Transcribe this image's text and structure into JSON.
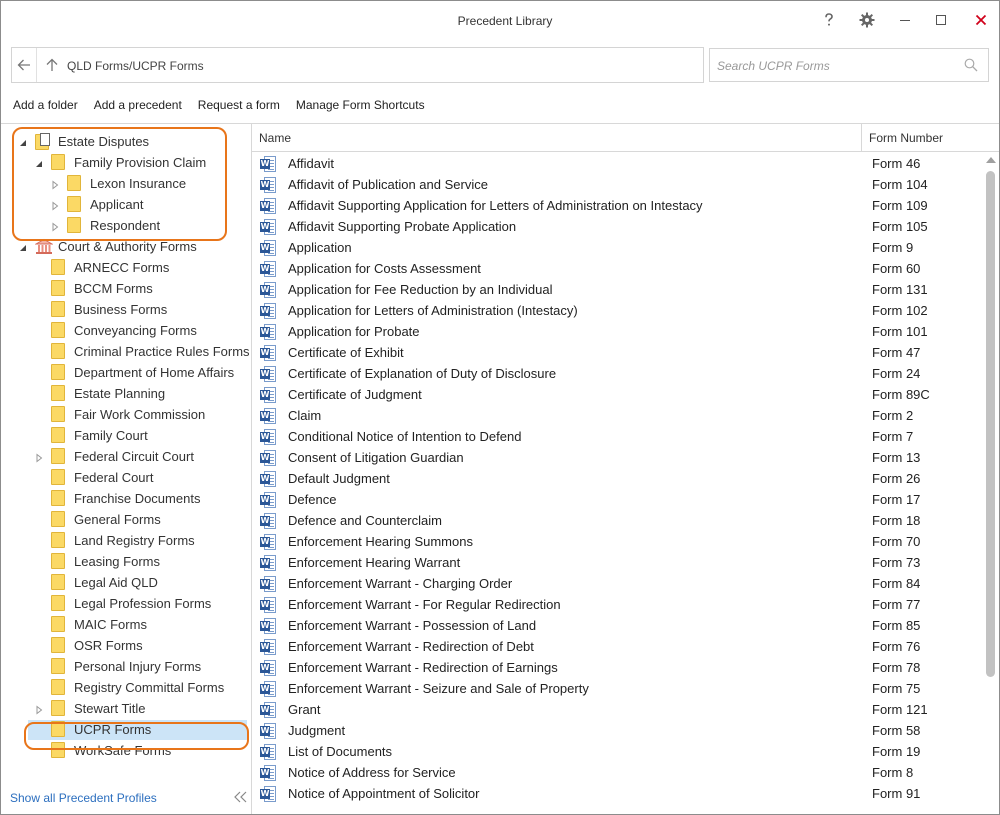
{
  "window": {
    "title": "Precedent Library",
    "buttons": [
      "help-icon",
      "gear-icon",
      "minimize-icon",
      "maximize-icon",
      "close-icon"
    ],
    "close_color": "#d0021b"
  },
  "nav": {
    "path": "QLD Forms/UCPR Forms",
    "search_placeholder": "Search UCPR Forms"
  },
  "toolbar": {
    "add_folder": "Add a folder",
    "add_precedent": "Add a precedent",
    "request_form": "Request a form",
    "manage_shortcuts": "Manage Form Shortcuts"
  },
  "tree": {
    "items": [
      {
        "label": "Estate Disputes",
        "level": 0,
        "expander": "expanded",
        "icon": "folder-document-icon"
      },
      {
        "label": "Family Provision Claim",
        "level": 1,
        "expander": "expanded",
        "icon": "folder-icon"
      },
      {
        "label": "Lexon Insurance",
        "level": 2,
        "expander": "collapsed",
        "icon": "folder-icon"
      },
      {
        "label": "Applicant",
        "level": 2,
        "expander": "collapsed",
        "icon": "folder-icon"
      },
      {
        "label": "Respondent",
        "level": 2,
        "expander": "collapsed",
        "icon": "folder-icon"
      },
      {
        "label": "Court & Authority Forms",
        "level": 0,
        "expander": "expanded",
        "icon": "court-building-icon"
      },
      {
        "label": "ARNECC Forms",
        "level": 1,
        "expander": "none",
        "icon": "folder-icon"
      },
      {
        "label": "BCCM Forms",
        "level": 1,
        "expander": "none",
        "icon": "folder-icon"
      },
      {
        "label": "Business Forms",
        "level": 1,
        "expander": "none",
        "icon": "folder-icon"
      },
      {
        "label": "Conveyancing Forms",
        "level": 1,
        "expander": "none",
        "icon": "folder-icon"
      },
      {
        "label": "Criminal Practice Rules Forms",
        "level": 1,
        "expander": "none",
        "icon": "folder-icon"
      },
      {
        "label": "Department of Home Affairs",
        "level": 1,
        "expander": "none",
        "icon": "folder-icon"
      },
      {
        "label": "Estate Planning",
        "level": 1,
        "expander": "none",
        "icon": "folder-icon"
      },
      {
        "label": "Fair Work Commission",
        "level": 1,
        "expander": "none",
        "icon": "folder-icon"
      },
      {
        "label": "Family Court",
        "level": 1,
        "expander": "none",
        "icon": "folder-icon"
      },
      {
        "label": "Federal Circuit Court",
        "level": 1,
        "expander": "collapsed",
        "icon": "folder-icon"
      },
      {
        "label": "Federal Court",
        "level": 1,
        "expander": "none",
        "icon": "folder-icon"
      },
      {
        "label": "Franchise Documents",
        "level": 1,
        "expander": "none",
        "icon": "folder-icon"
      },
      {
        "label": "General Forms",
        "level": 1,
        "expander": "none",
        "icon": "folder-icon"
      },
      {
        "label": "Land Registry Forms",
        "level": 1,
        "expander": "none",
        "icon": "folder-icon"
      },
      {
        "label": "Leasing Forms",
        "level": 1,
        "expander": "none",
        "icon": "folder-icon"
      },
      {
        "label": "Legal Aid QLD",
        "level": 1,
        "expander": "none",
        "icon": "folder-icon"
      },
      {
        "label": "Legal Profession Forms",
        "level": 1,
        "expander": "none",
        "icon": "folder-icon"
      },
      {
        "label": "MAIC Forms",
        "level": 1,
        "expander": "none",
        "icon": "folder-icon"
      },
      {
        "label": "OSR Forms",
        "level": 1,
        "expander": "none",
        "icon": "folder-icon"
      },
      {
        "label": "Personal Injury Forms",
        "level": 1,
        "expander": "none",
        "icon": "folder-icon"
      },
      {
        "label": "Registry Committal Forms",
        "level": 1,
        "expander": "none",
        "icon": "folder-icon"
      },
      {
        "label": "Stewart Title",
        "level": 1,
        "expander": "collapsed",
        "icon": "folder-icon"
      },
      {
        "label": "UCPR Forms",
        "level": 1,
        "expander": "none",
        "icon": "folder-icon",
        "selected": true
      },
      {
        "label": "WorkSafe Forms",
        "level": 1,
        "expander": "none",
        "icon": "folder-icon"
      }
    ],
    "show_all": "Show all Precedent Profiles"
  },
  "list": {
    "columns": {
      "name": "Name",
      "number": "Form Number"
    },
    "rows": [
      {
        "name": "Affidavit",
        "number": "Form 46"
      },
      {
        "name": "Affidavit of Publication and Service",
        "number": "Form 104"
      },
      {
        "name": "Affidavit Supporting Application for Letters of Administration on Intestacy",
        "number": "Form 109"
      },
      {
        "name": "Affidavit Supporting Probate Application",
        "number": "Form 105"
      },
      {
        "name": "Application",
        "number": "Form 9"
      },
      {
        "name": "Application for Costs Assessment",
        "number": "Form 60"
      },
      {
        "name": "Application for Fee Reduction by an Individual",
        "number": "Form 131"
      },
      {
        "name": "Application for Letters of Administration (Intestacy)",
        "number": "Form 102"
      },
      {
        "name": "Application for Probate",
        "number": "Form 101"
      },
      {
        "name": "Certificate of Exhibit",
        "number": "Form 47"
      },
      {
        "name": "Certificate of Explanation of Duty of Disclosure",
        "number": "Form 24"
      },
      {
        "name": "Certificate of Judgment",
        "number": "Form 89C"
      },
      {
        "name": "Claim",
        "number": "Form 2"
      },
      {
        "name": "Conditional Notice of Intention to Defend",
        "number": "Form 7"
      },
      {
        "name": "Consent of Litigation Guardian",
        "number": "Form 13"
      },
      {
        "name": "Default Judgment",
        "number": "Form 26"
      },
      {
        "name": "Defence",
        "number": "Form 17"
      },
      {
        "name": "Defence and Counterclaim",
        "number": "Form 18"
      },
      {
        "name": "Enforcement Hearing Summons",
        "number": "Form 70"
      },
      {
        "name": "Enforcement Hearing Warrant",
        "number": "Form 73"
      },
      {
        "name": "Enforcement Warrant - Charging Order",
        "number": "Form 84"
      },
      {
        "name": "Enforcement Warrant - For Regular Redirection",
        "number": "Form 77"
      },
      {
        "name": "Enforcement Warrant - Possession of Land",
        "number": "Form 85"
      },
      {
        "name": "Enforcement Warrant - Redirection of Debt",
        "number": "Form 76"
      },
      {
        "name": "Enforcement Warrant - Redirection of Earnings",
        "number": "Form 78"
      },
      {
        "name": "Enforcement Warrant - Seizure and Sale of Property",
        "number": "Form 75"
      },
      {
        "name": "Grant",
        "number": "Form 121"
      },
      {
        "name": "Judgment",
        "number": "Form 58"
      },
      {
        "name": "List of Documents",
        "number": "Form 19"
      },
      {
        "name": "Notice of Address for Service",
        "number": "Form 8"
      },
      {
        "name": "Notice of Appointment of Solicitor",
        "number": "Form 91"
      }
    ]
  },
  "highlight_color": "#e8751a",
  "selection_color": "#cce4f7"
}
